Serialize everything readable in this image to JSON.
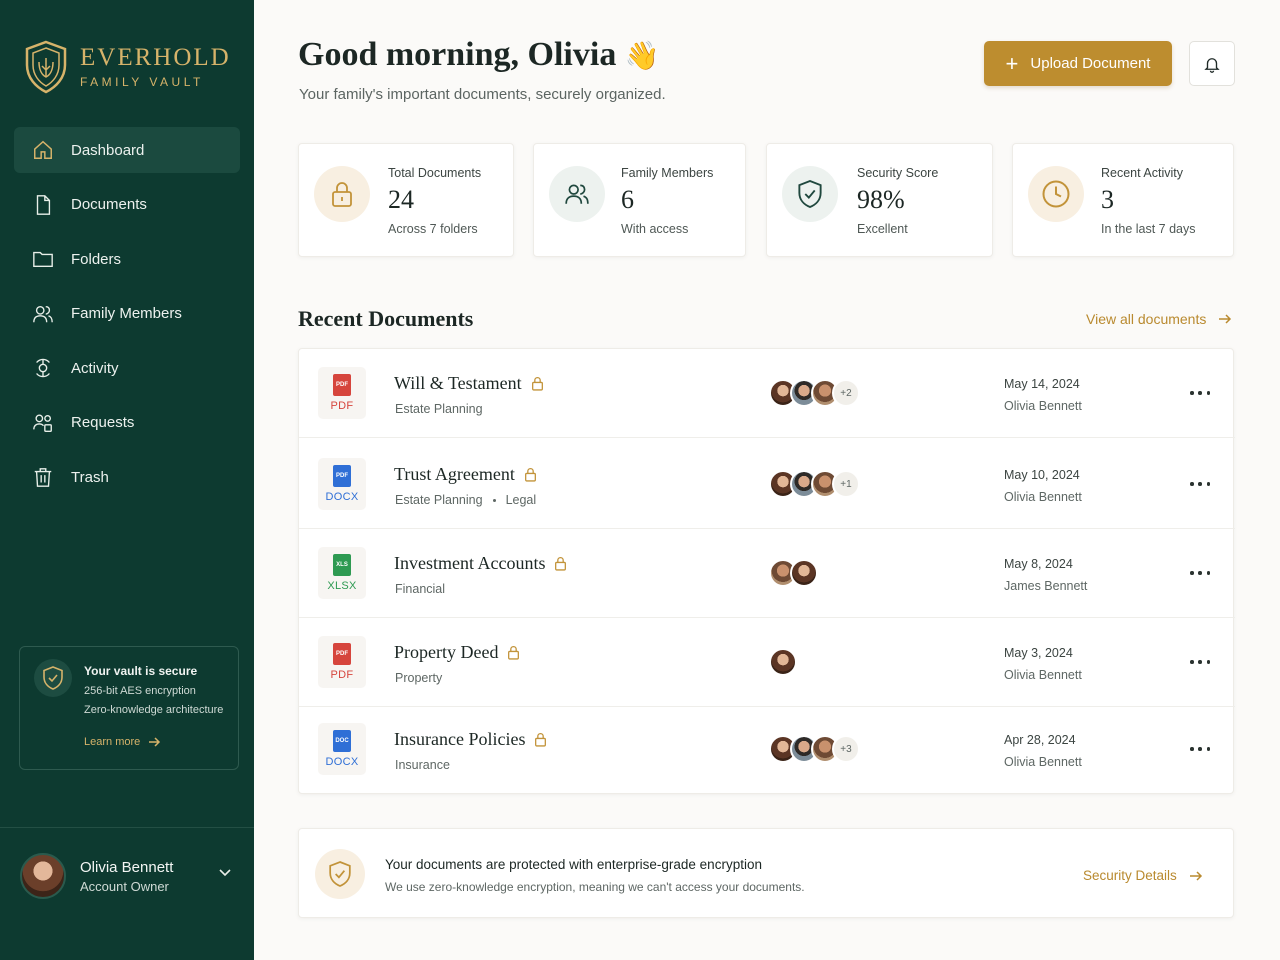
{
  "brand": {
    "name": "EVERHOLD",
    "subtitle": "FAMILY VAULT"
  },
  "sidebar": {
    "items": [
      {
        "label": "Dashboard",
        "icon": "home-icon",
        "active": true
      },
      {
        "label": "Documents",
        "icon": "file-icon"
      },
      {
        "label": "Folders",
        "icon": "folder-icon"
      },
      {
        "label": "Family Members",
        "icon": "users-icon"
      },
      {
        "label": "Activity",
        "icon": "activity-icon"
      },
      {
        "label": "Requests",
        "icon": "requests-icon"
      },
      {
        "label": "Trash",
        "icon": "trash-icon"
      }
    ],
    "secure_card": {
      "title": "Your vault is secure",
      "line1": "256-bit AES encryption",
      "line2": "Zero-knowledge architecture",
      "link": "Learn more"
    },
    "user": {
      "name": "Olivia Bennett",
      "role": "Account Owner"
    }
  },
  "header": {
    "greeting": "Good morning, Olivia",
    "wave": "👋",
    "subtitle": "Your family's important documents, securely organized.",
    "upload_label": "Upload Document"
  },
  "stats": [
    {
      "label": "Total Documents",
      "value": "24",
      "note": "Across 7 folders",
      "icon": "lock-icon"
    },
    {
      "label": "Family Members",
      "value": "6",
      "note": "With access",
      "icon": "users-icon"
    },
    {
      "label": "Security Score",
      "value": "98%",
      "note": "Excellent",
      "icon": "shield-check-icon"
    },
    {
      "label": "Recent Activity",
      "value": "3",
      "note": "In the last 7 days",
      "icon": "clock-icon"
    }
  ],
  "recent": {
    "title": "Recent Documents",
    "view_all": "View all documents",
    "rows": [
      {
        "name": "Will & Testament",
        "tags": [
          "Estate Planning"
        ],
        "ext": "PDF",
        "badge": "PDF",
        "avatars": 3,
        "more": "+2",
        "date": "May 14, 2024",
        "owner": "Olivia Bennett"
      },
      {
        "name": "Trust Agreement",
        "tags": [
          "Estate Planning",
          "Legal"
        ],
        "ext": "DOCX",
        "badge": "PDF",
        "avatars": 3,
        "more": "+1",
        "date": "May 10, 2024",
        "owner": "Olivia Bennett"
      },
      {
        "name": "Investment Accounts",
        "tags": [
          "Financial"
        ],
        "ext": "XLSX",
        "badge": "XLS",
        "avatars": 2,
        "more": "",
        "date": "May 8, 2024",
        "owner": "James Bennett"
      },
      {
        "name": "Property Deed",
        "tags": [
          "Property"
        ],
        "ext": "PDF",
        "badge": "PDF",
        "avatars": 1,
        "more": "",
        "date": "May 3, 2024",
        "owner": "Olivia Bennett"
      },
      {
        "name": "Insurance Policies",
        "tags": [
          "Insurance"
        ],
        "ext": "DOCX",
        "badge": "DOC",
        "avatars": 3,
        "more": "+3",
        "date": "Apr 28, 2024",
        "owner": "Olivia Bennett"
      }
    ]
  },
  "encryption": {
    "title": "Your documents are protected with enterprise-grade encryption",
    "subtitle": "We use zero-knowledge encryption, meaning we can't access your documents.",
    "link": "Security Details"
  },
  "colors": {
    "sidebar": "#0d3a30",
    "gold": "#bd8d2f",
    "pdf": "#d6453d",
    "docx": "#2f6fd6",
    "xlsx": "#2e9a52"
  }
}
